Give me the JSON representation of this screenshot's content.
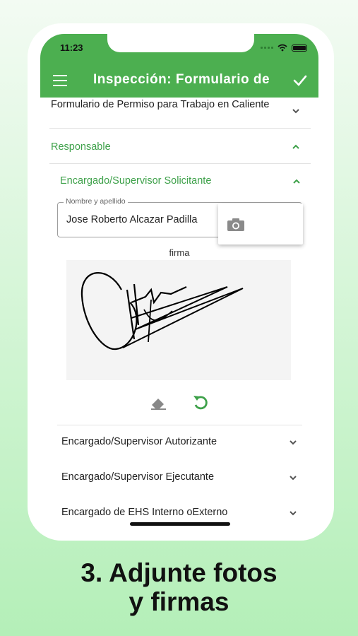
{
  "status_bar": {
    "time": "11:23"
  },
  "app_bar": {
    "title": "Inspección: Formulario de Permiso para Trabajo en Caliente"
  },
  "form": {
    "collapsed_section": "Formulario de Permiso para Trabajo en Caliente",
    "responsable_header": "Responsable",
    "solicitante_header": "Encargado/Supervisor Solicitante",
    "name_field": {
      "label": "Nombre y apellido",
      "value": "Jose Roberto Alcazar Padilla"
    },
    "signature_label": "firma",
    "other_sections": [
      "Encargado/Supervisor Autorizante",
      "Encargado/Supervisor Ejecutante",
      "Encargado de EHS Interno oExterno"
    ]
  },
  "caption": {
    "line1": "3. Adjunte fotos",
    "line2": "y firmas"
  },
  "colors": {
    "accent": "#4caf50",
    "accent_text": "#3ea14a"
  },
  "icons": [
    "menu-icon",
    "check-icon",
    "chevron-down-icon",
    "chevron-up-icon",
    "camera-icon",
    "eraser-icon",
    "undo-icon"
  ]
}
